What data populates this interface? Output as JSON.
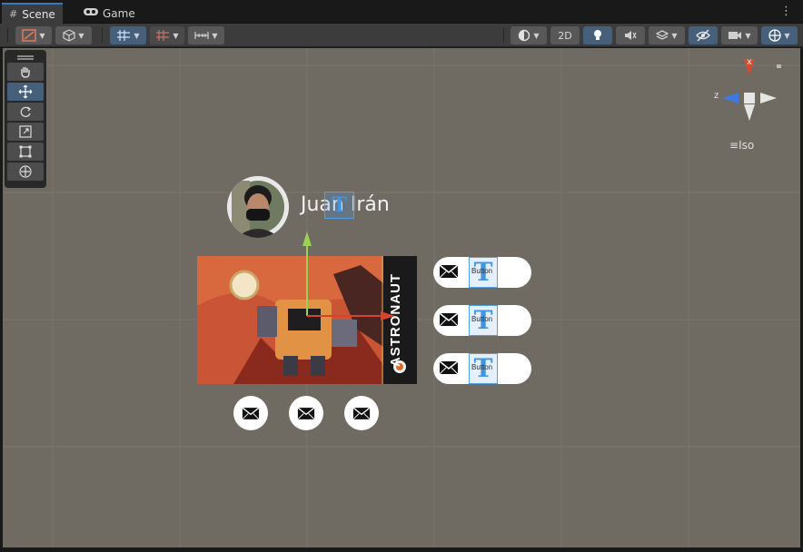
{
  "tabs": [
    {
      "label": "Scene",
      "icon": "grid-icon"
    },
    {
      "label": "Game",
      "icon": "gamepad-icon"
    }
  ],
  "toolbar": {
    "mode_2d_label": "2D"
  },
  "tools": [
    "hand-tool",
    "move-tool",
    "rotate-tool",
    "scale-tool",
    "rect-tool",
    "transform-tool"
  ],
  "gizmo": {
    "x_label": "x",
    "z_label": "z",
    "projection_label": "Iso",
    "colors": {
      "x": "#d84a2c",
      "y": "#e6e6e6",
      "z": "#3d7ae0"
    }
  },
  "profile": {
    "name": "Juan Irán",
    "selected_glyph": "T"
  },
  "poster": {
    "title": "ASTRONAUT"
  },
  "buttons": [
    {
      "label": "Button",
      "glyph": "T"
    },
    {
      "label": "Button",
      "glyph": "T"
    },
    {
      "label": "Button",
      "glyph": "T"
    }
  ],
  "icon_buttons": [
    "mail-icon",
    "mail-icon",
    "mail-icon"
  ],
  "handle_colors": {
    "y": "#9bd256",
    "x": "#d8432a"
  }
}
